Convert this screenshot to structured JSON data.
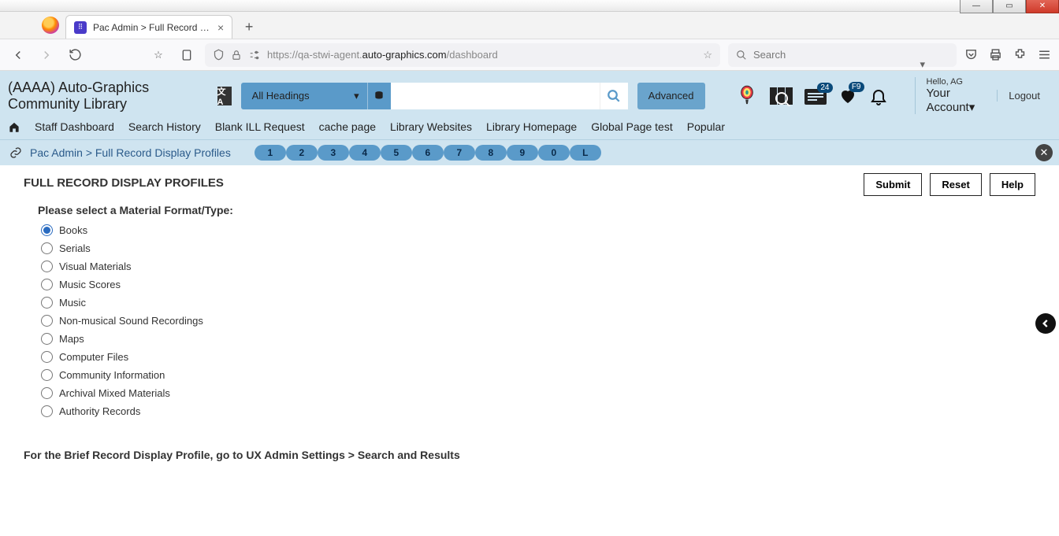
{
  "browser": {
    "tab_title": "Pac Admin > Full Record Displa",
    "url_prefix": "https://qa-stwi-agent.",
    "url_bold": "auto-graphics.com",
    "url_suffix": "/dashboard",
    "search_placeholder": "Search"
  },
  "header": {
    "library_name": "(AAAA) Auto-Graphics Community Library",
    "search_scope": "All Headings",
    "advanced": "Advanced",
    "hello": "Hello, AG",
    "account": "Your Account",
    "logout": "Logout",
    "badge_reading": "24",
    "badge_heart": "F9"
  },
  "nav": {
    "items": [
      "Staff Dashboard",
      "Search History",
      "Blank ILL Request",
      "cache page",
      "Library Websites",
      "Library Homepage",
      "Global Page test",
      "Popular"
    ]
  },
  "breadcrumb": {
    "text": "Pac Admin  >  Full Record Display Profiles",
    "pills": [
      "1",
      "2",
      "3",
      "4",
      "5",
      "6",
      "7",
      "8",
      "9",
      "0",
      "L"
    ]
  },
  "page": {
    "title": "FULL RECORD DISPLAY PROFILES",
    "submit": "Submit",
    "reset": "Reset",
    "help": "Help",
    "prompt": "Please select a Material Format/Type:",
    "formats": [
      {
        "label": "Books",
        "checked": true
      },
      {
        "label": "Serials",
        "checked": false
      },
      {
        "label": "Visual Materials",
        "checked": false
      },
      {
        "label": "Music Scores",
        "checked": false
      },
      {
        "label": "Music",
        "checked": false
      },
      {
        "label": "Non-musical Sound Recordings",
        "checked": false
      },
      {
        "label": "Maps",
        "checked": false
      },
      {
        "label": "Computer Files",
        "checked": false
      },
      {
        "label": "Community Information",
        "checked": false
      },
      {
        "label": "Archival Mixed Materials",
        "checked": false
      },
      {
        "label": "Authority Records",
        "checked": false
      }
    ],
    "footnote": "For the Brief Record Display Profile, go to UX Admin Settings > Search and Results"
  }
}
